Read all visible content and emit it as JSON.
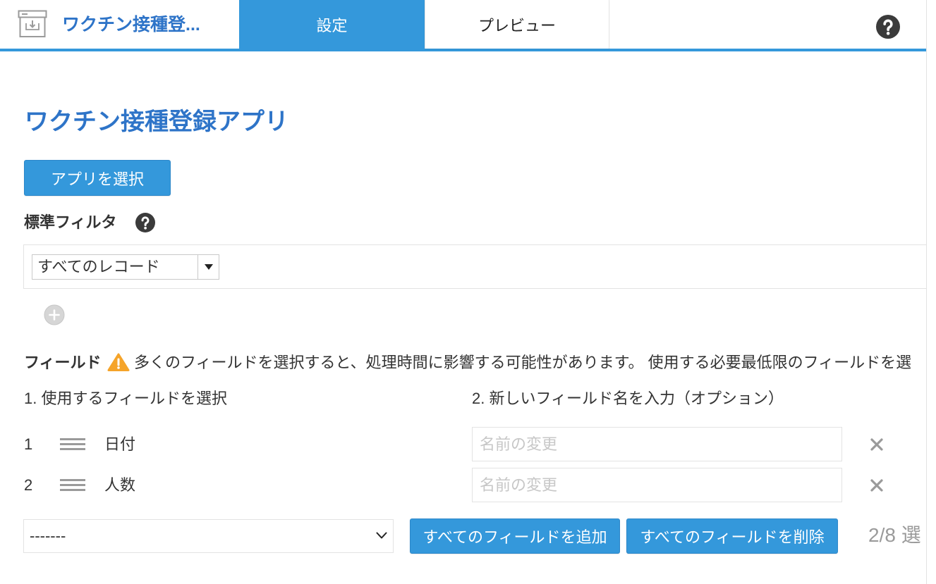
{
  "colors": {
    "accent": "#3498db",
    "title": "#2e74c8",
    "text": "#333333",
    "muted": "#9a9a9a",
    "placeholder": "#c7c7c7",
    "help": "#3b3b3b",
    "warning": "#f5a42a",
    "border": "#e3e3e3"
  },
  "header": {
    "app_icon": "app-download-icon",
    "app_title": "ワクチン接種登...",
    "tabs": [
      {
        "label": "設定",
        "active": true
      },
      {
        "label": "プレビュー",
        "active": false
      }
    ],
    "help_icon": "help-icon"
  },
  "main": {
    "title": "ワクチン接種登録アプリ",
    "select_app_button": "アプリを選択",
    "standard_filter": {
      "label": "標準フィルタ",
      "help_icon": "help-icon",
      "selected_value": "すべてのレコード",
      "dropdown_icon": "triangle-down-icon",
      "add_icon": "add-circle-icon"
    },
    "fields": {
      "label": "フィールド",
      "warning_icon": "warning-icon",
      "warning_text": "多くのフィールドを選択すると、処理時間に影響する可能性があります。 使用する必要最低限のフィールドを選",
      "column_headings": [
        "1. 使用するフィールドを選択",
        "2. 新しいフィールド名を入力（オプション）"
      ],
      "rows": [
        {
          "number": "1",
          "field_name": "日付",
          "rename_value": "",
          "rename_placeholder": "名前の変更"
        },
        {
          "number": "2",
          "field_name": "人数",
          "rename_value": "",
          "rename_placeholder": "名前の変更"
        }
      ],
      "row_drag_icon": "drag-handle-icon",
      "row_remove_icon": "close-icon",
      "add_field_select": {
        "selected_value": "-------",
        "dropdown_icon": "chevron-down-icon"
      },
      "add_all_button": "すべてのフィールドを追加",
      "remove_all_button": "すべてのフィールドを削除",
      "selection_count": "2/8 選"
    }
  }
}
